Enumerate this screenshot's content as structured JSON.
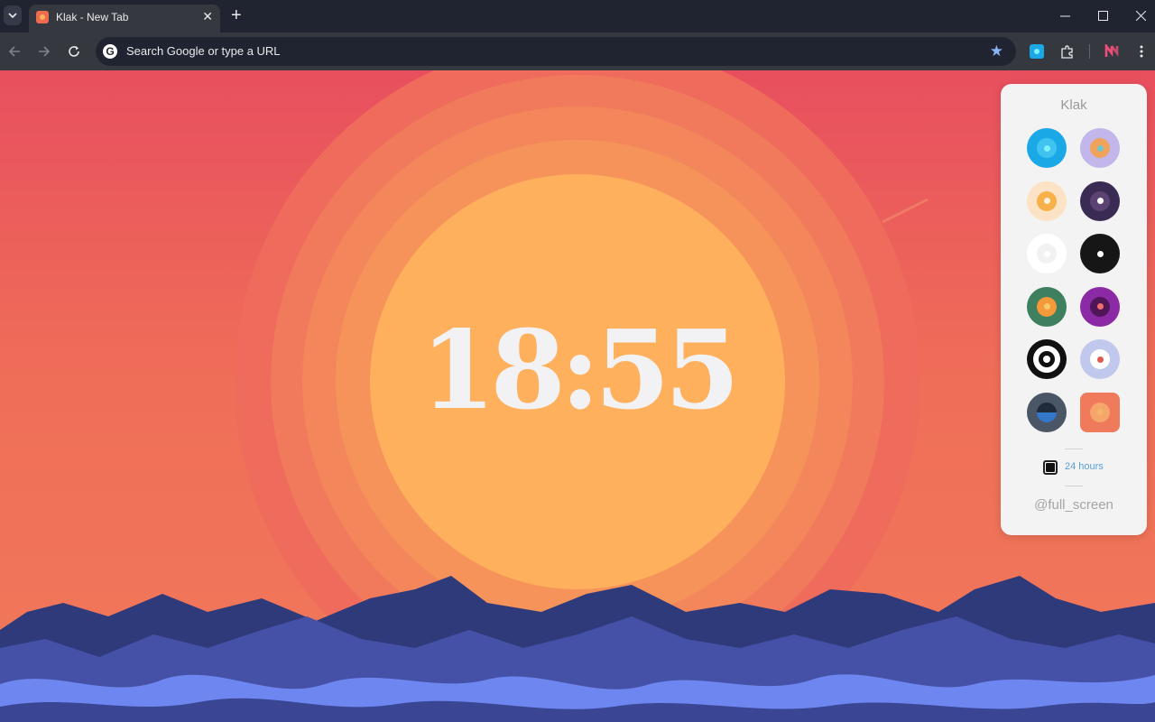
{
  "browser": {
    "tab_title": "Klak - New Tab",
    "omnibox_placeholder": "Search Google or type a URL",
    "google_letter": "G"
  },
  "clock": {
    "time": "18:55"
  },
  "panel": {
    "title": "Klak",
    "themes": [
      {
        "name": "blue",
        "outer": "#1aa9e6",
        "inner": "#40c3f0",
        "dot": "#7ef1ff"
      },
      {
        "name": "lavender",
        "outer": "#c2b6ea",
        "inner": "#f0a35a",
        "dot": "#6fc7c9"
      },
      {
        "name": "peach",
        "outer": "#fde3c5",
        "inner": "#f8b04a",
        "dot": "#fff2df"
      },
      {
        "name": "plum",
        "outer": "#3a2b55",
        "inner": "#5d4373",
        "dot": "#ffffff"
      },
      {
        "name": "white",
        "outer": "#ffffff",
        "inner": "#f2f2f2",
        "dot": "#ffffff"
      },
      {
        "name": "black",
        "outer": "#161616",
        "inner": "#161616",
        "dot": "#ffffff"
      },
      {
        "name": "green",
        "outer": "#3e7f5f",
        "inner": "#f59a3b",
        "dot": "#f7c96a"
      },
      {
        "name": "purple",
        "outer": "#8c2aa5",
        "inner": "#511657",
        "dot": "#f26d6b"
      },
      {
        "name": "target",
        "outer": "#111111",
        "inner": "#ffffff",
        "dot": "#111111"
      },
      {
        "name": "periwinkle",
        "outer": "#c0c8ee",
        "inner": "#ffffff",
        "dot": "#e0584f"
      },
      {
        "name": "slate",
        "outer": "#4a5566",
        "inner": "#3277c9",
        "dot": "#1f2a3a"
      },
      {
        "name": "coral",
        "outer": "#f07b5c",
        "inner": "#f7a66b",
        "dot": "#f5b56a"
      }
    ],
    "hours_label": "24 hours",
    "fullscreen_label": "@full_screen"
  },
  "colors": {
    "sun": "#ffb05c",
    "sky_top": "#e84f5e",
    "mountain_dark": "#2f3a7a",
    "mountain_mid": "#4551a6",
    "mountain_light": "#6e86f0"
  }
}
